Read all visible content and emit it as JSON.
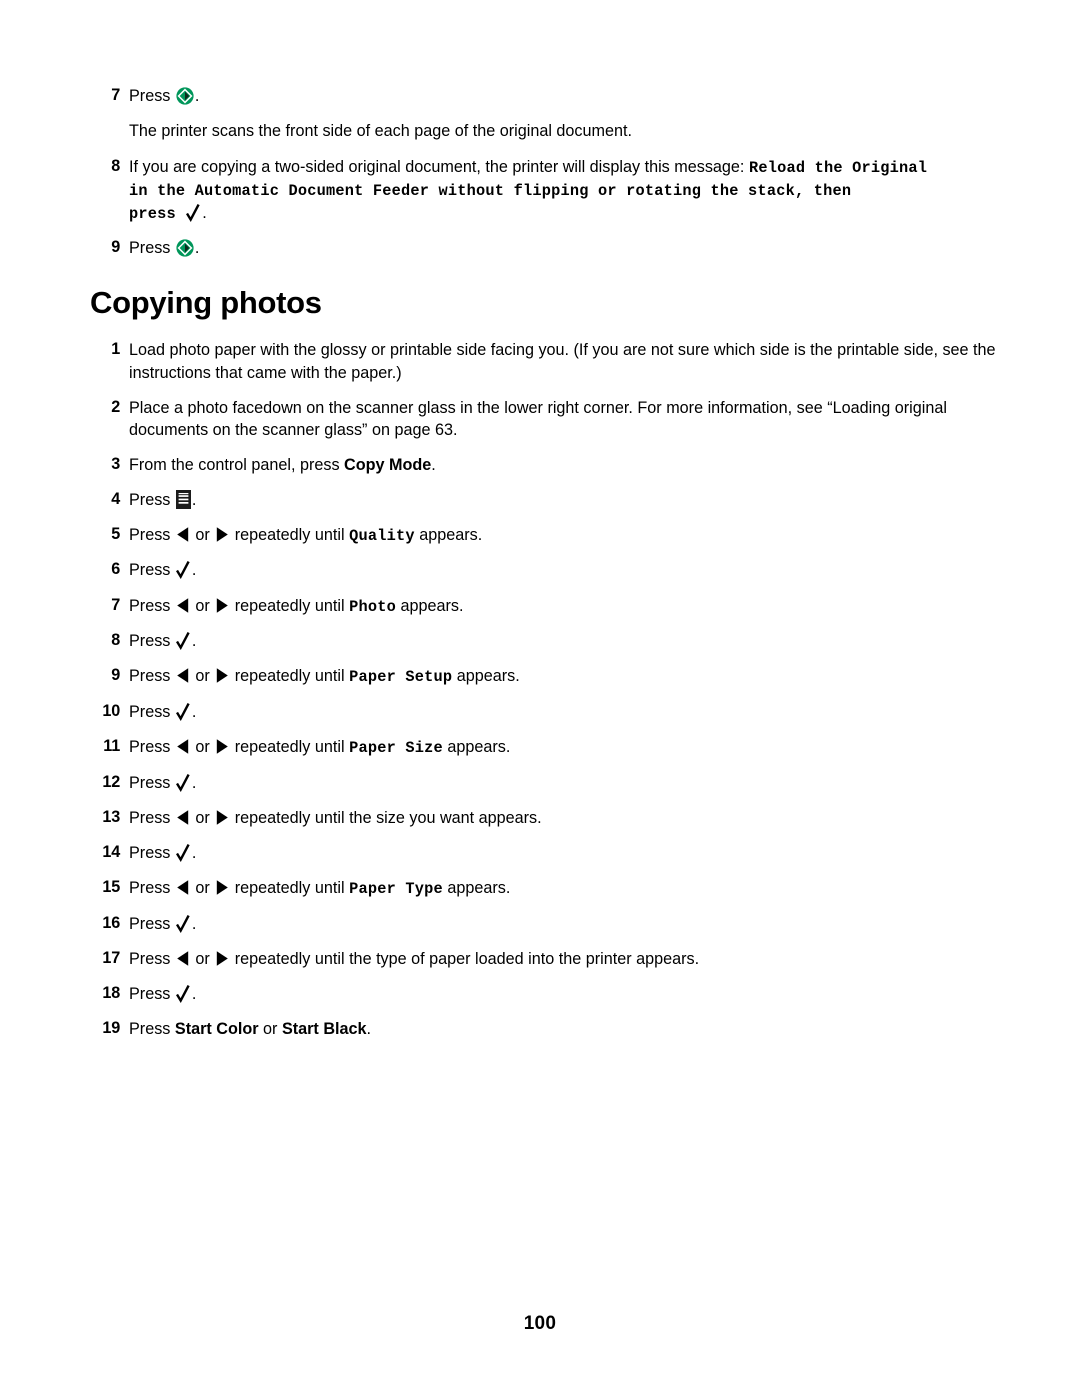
{
  "document": {
    "page_number": "100",
    "accent_green": "#00965A"
  },
  "top_section": {
    "steps": [
      {
        "number": "7",
        "prefix": "Press ",
        "icon": "start-button-icon",
        "suffix": "."
      },
      {
        "number": "",
        "text": "The printer scans the front side of each page of the original document."
      },
      {
        "number": "8",
        "prefix": "If you are copying a two-sided original document, the printer will display this message: ",
        "mono_message_line1": "Reload the Original",
        "mono_message_line2": "in the Automatic Document Feeder without flipping or rotating the stack, then",
        "mono_message_line3": "press ",
        "icon": "check-button-icon",
        "suffix": "."
      },
      {
        "number": "9",
        "prefix": "Press ",
        "icon": "start-button-icon",
        "suffix": "."
      }
    ]
  },
  "section": {
    "heading": "Copying photos",
    "steps": [
      {
        "number": "1",
        "text": "Load photo paper with the glossy or printable side facing you. (If you are not sure which side is the printable side, see the instructions that came with the paper.)"
      },
      {
        "number": "2",
        "text": "Place a photo facedown on the scanner glass in the lower right corner. For more information, see “Loading original documents on the scanner glass” on page 63."
      },
      {
        "number": "3",
        "prefix": "From the control panel, press ",
        "bold": "Copy Mode",
        "suffix": "."
      },
      {
        "number": "4",
        "prefix": "Press ",
        "icon": "menu-button-icon",
        "suffix": "."
      },
      {
        "number": "5",
        "prefix": "Press ",
        "icon_left": "left-arrow-icon",
        "middle": " or ",
        "icon_right": "right-arrow-icon",
        "after": " repeatedly until ",
        "mono": "Quality",
        "suffix": " appears."
      },
      {
        "number": "6",
        "prefix": "Press ",
        "icon": "check-button-icon",
        "suffix": "."
      },
      {
        "number": "7",
        "prefix": "Press ",
        "icon_left": "left-arrow-icon",
        "middle": " or ",
        "icon_right": "right-arrow-icon",
        "after": " repeatedly until ",
        "mono": "Photo",
        "suffix": " appears."
      },
      {
        "number": "8",
        "prefix": "Press ",
        "icon": "check-button-icon",
        "suffix": "."
      },
      {
        "number": "9",
        "prefix": "Press ",
        "icon_left": "left-arrow-icon",
        "middle": " or ",
        "icon_right": "right-arrow-icon",
        "after": " repeatedly until ",
        "mono": "Paper Setup",
        "suffix": " appears."
      },
      {
        "number": "10",
        "prefix": "Press ",
        "icon": "check-button-icon",
        "suffix": "."
      },
      {
        "number": "11",
        "prefix": "Press ",
        "icon_left": "left-arrow-icon",
        "middle": " or ",
        "icon_right": "right-arrow-icon",
        "after": " repeatedly until ",
        "mono": "Paper Size",
        "suffix": " appears."
      },
      {
        "number": "12",
        "prefix": "Press ",
        "icon": "check-button-icon",
        "suffix": "."
      },
      {
        "number": "13",
        "prefix": "Press ",
        "icon_left": "left-arrow-icon",
        "middle": " or ",
        "icon_right": "right-arrow-icon",
        "after": " repeatedly until the size you want appears."
      },
      {
        "number": "14",
        "prefix": "Press ",
        "icon": "check-button-icon",
        "suffix": "."
      },
      {
        "number": "15",
        "prefix": "Press ",
        "icon_left": "left-arrow-icon",
        "middle": " or ",
        "icon_right": "right-arrow-icon",
        "after": " repeatedly until ",
        "mono": "Paper Type",
        "suffix": " appears."
      },
      {
        "number": "16",
        "prefix": "Press ",
        "icon": "check-button-icon",
        "suffix": "."
      },
      {
        "number": "17",
        "prefix": "Press ",
        "icon_left": "left-arrow-icon",
        "middle": " or ",
        "icon_right": "right-arrow-icon",
        "after": " repeatedly until the type of paper loaded into the printer appears."
      },
      {
        "number": "18",
        "prefix": "Press ",
        "icon": "check-button-icon",
        "suffix": "."
      },
      {
        "number": "19",
        "prefix": "Press ",
        "bold": "Start Color",
        "middle": " or ",
        "bold2": "Start Black",
        "suffix": "."
      }
    ]
  }
}
